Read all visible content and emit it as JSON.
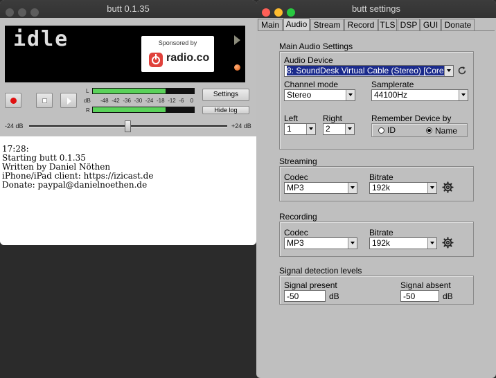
{
  "main_window": {
    "title": "butt 0.1.35",
    "lcd_status": "idle",
    "sponsor": {
      "label": "Sponsored by",
      "name": "radio.co",
      "brand_color": "#e0413b"
    },
    "vu_meter": {
      "left_label": "L",
      "right_label": "R",
      "db_label": "dB",
      "scale": [
        "-48",
        "-42",
        "-36",
        "-30",
        "-24",
        "-18",
        "-12",
        "-6",
        "0"
      ],
      "left_level": 0.72,
      "right_level": 0.72
    },
    "buttons": {
      "settings": "Settings",
      "hide_log": "Hide log"
    },
    "gain": {
      "min_label": "-24 dB",
      "max_label": "+24 dB",
      "value": 0.5
    },
    "log_lines": [
      "17:28:",
      "Starting butt 0.1.35",
      "Written by Daniel Nöthen",
      "iPhone/iPad client: https://izicast.de",
      "Donate: paypal@danielnoethen.de"
    ]
  },
  "settings_window": {
    "title": "butt settings",
    "tabs": [
      "Main",
      "Audio",
      "Stream",
      "Record",
      "TLS",
      "DSP",
      "GUI",
      "Donate"
    ],
    "active_tab": "Audio",
    "main_audio": {
      "title": "Main Audio Settings",
      "device_label": "Audio Device",
      "device_value": "8: SoundDesk Virtual Cable (Stereo) [Core",
      "channel_mode_label": "Channel mode",
      "channel_mode_value": "Stereo",
      "samplerate_label": "Samplerate",
      "samplerate_value": "44100Hz",
      "left_label": "Left",
      "left_value": "1",
      "right_label": "Right",
      "right_value": "2",
      "remember_label": "Remember Device by",
      "remember_options": [
        "ID",
        "Name"
      ],
      "remember_selected": "Name"
    },
    "streaming": {
      "title": "Streaming",
      "codec_label": "Codec",
      "codec_value": "MP3",
      "bitrate_label": "Bitrate",
      "bitrate_value": "192k"
    },
    "recording": {
      "title": "Recording",
      "codec_label": "Codec",
      "codec_value": "MP3",
      "bitrate_label": "Bitrate",
      "bitrate_value": "192k"
    },
    "signal": {
      "title": "Signal detection levels",
      "present_label": "Signal present",
      "present_value": "-50",
      "present_unit": "dB",
      "absent_label": "Signal absent",
      "absent_value": "-50",
      "absent_unit": "dB"
    }
  }
}
